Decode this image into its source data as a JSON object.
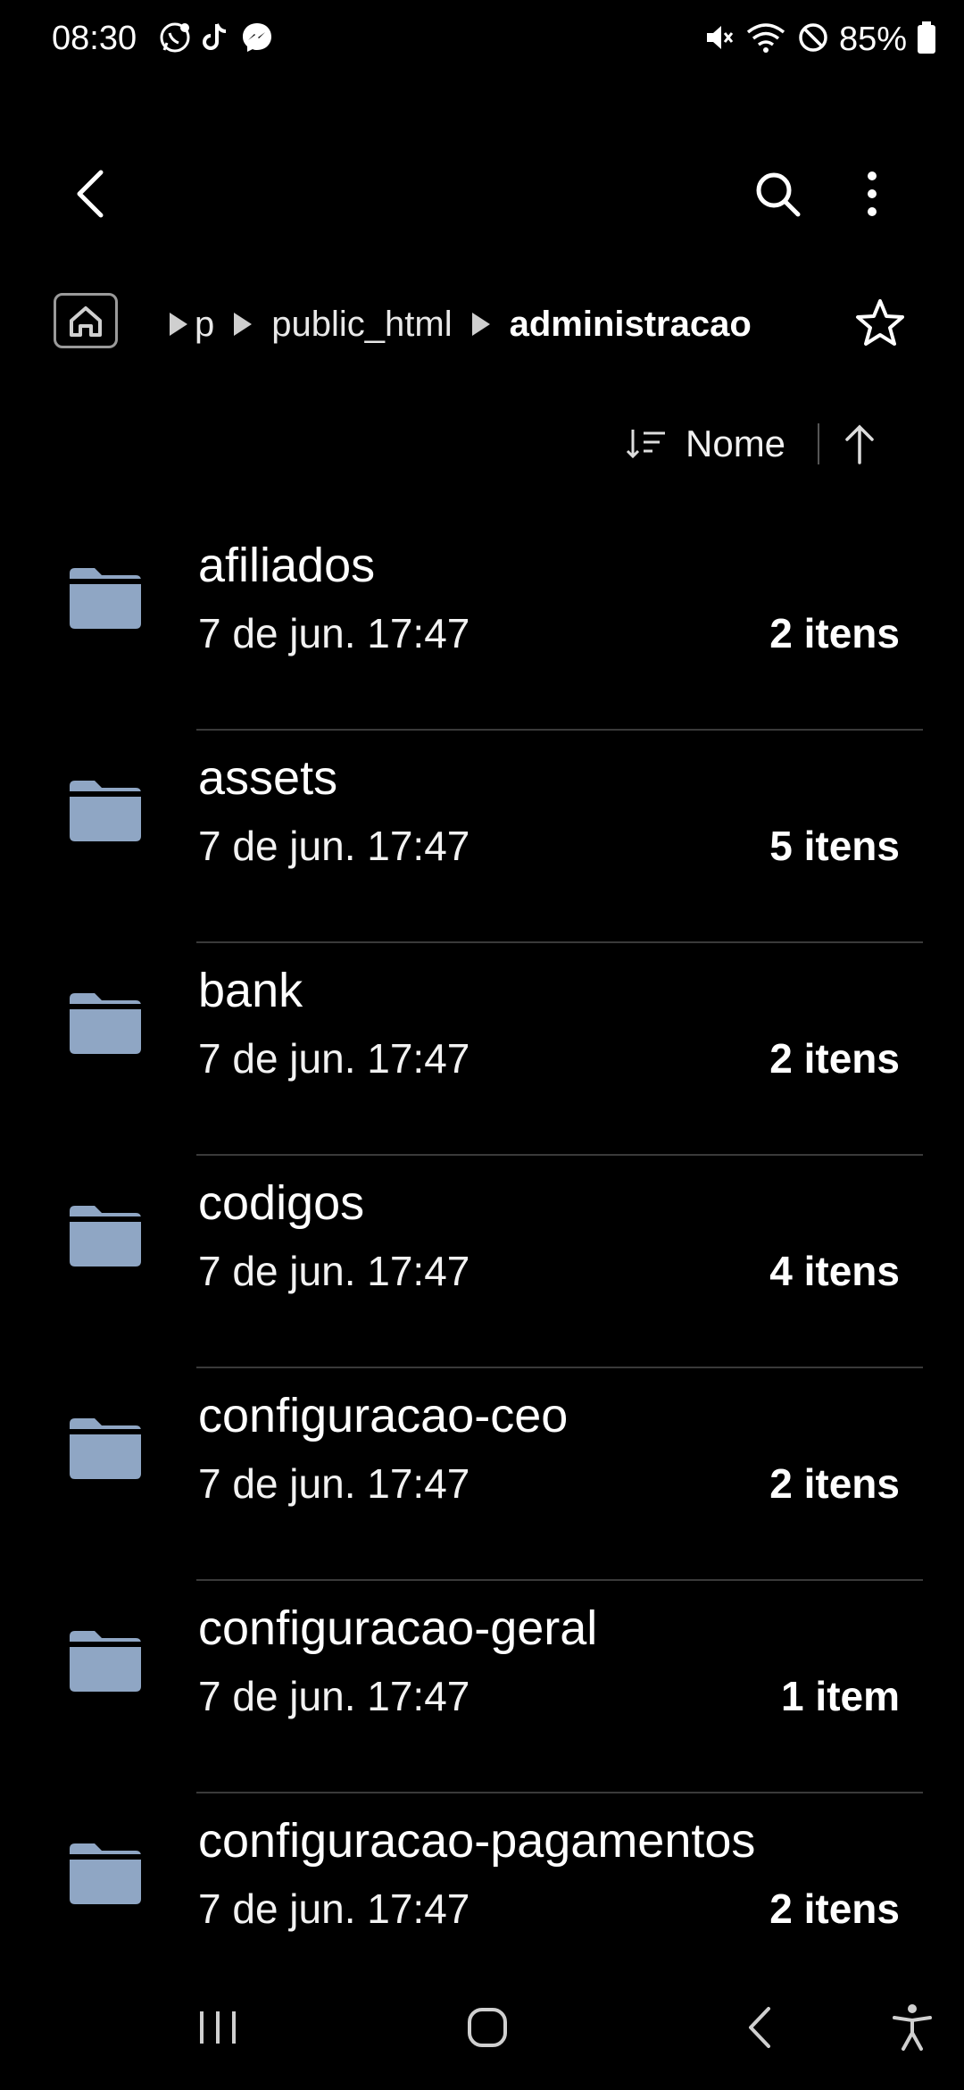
{
  "status_bar": {
    "time": "08:30",
    "notification_icons": [
      "whatsapp-icon",
      "tiktok-icon",
      "messenger-icon"
    ],
    "system_icons": [
      "mute-icon",
      "wifi-icon",
      "do-not-disturb-icon"
    ],
    "battery_percent": "85%"
  },
  "top_bar": {
    "icons": [
      "back-arrow-icon",
      "search-icon",
      "more-vertical-icon"
    ]
  },
  "breadcrumb": {
    "partial": "p",
    "items": [
      "public_html",
      "administracao"
    ]
  },
  "sort": {
    "label": "Nome",
    "direction": "ascending"
  },
  "files": [
    {
      "name": "afiliados",
      "date": "7 de jun. 17:47",
      "count": "2 itens"
    },
    {
      "name": "assets",
      "date": "7 de jun. 17:47",
      "count": "5 itens"
    },
    {
      "name": "bank",
      "date": "7 de jun. 17:47",
      "count": "2 itens"
    },
    {
      "name": "codigos",
      "date": "7 de jun. 17:47",
      "count": "4 itens"
    },
    {
      "name": "configuracao-ceo",
      "date": "7 de jun. 17:47",
      "count": "2 itens"
    },
    {
      "name": "configuracao-geral",
      "date": "7 de jun. 17:47",
      "count": "1 item"
    },
    {
      "name": "configuracao-pagamentos",
      "date": "7 de jun. 17:47",
      "count": "2 itens"
    }
  ],
  "colors": {
    "background": "#000000",
    "folder": "#8fa6c4",
    "divider": "#3a3a3a"
  },
  "nav_bar": {
    "icons": [
      "recents-icon",
      "home-icon",
      "back-icon",
      "accessibility-icon"
    ]
  }
}
